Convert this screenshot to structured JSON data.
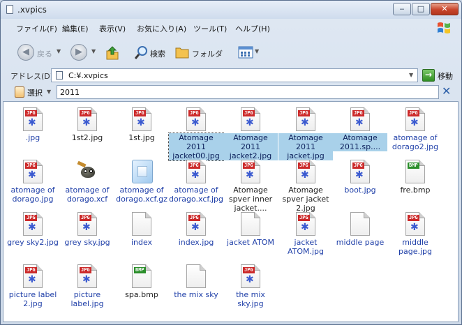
{
  "window": {
    "title": ".xvpics",
    "controls": {
      "minimize": "‒",
      "maximize": "□",
      "close": "✕"
    }
  },
  "menubar": {
    "items": [
      "ファイル(F)",
      "編集(E)",
      "表示(V)",
      "お気に入り(A)",
      "ツール(T)",
      "ヘルプ(H)"
    ]
  },
  "toolbar": {
    "back_label": "戻る",
    "search_label": "検索",
    "folders_label": "フォルダ"
  },
  "addressbar": {
    "label": "アドレス(D)",
    "path": "C:¥.xvpics",
    "go_label": "移動"
  },
  "filterbar": {
    "select_label": "選択",
    "filter_value": "2011"
  },
  "files": [
    {
      "name": ".jpg",
      "type": "jpg",
      "state": "link"
    },
    {
      "name": "1st2.jpg",
      "type": "jpg",
      "state": "plain"
    },
    {
      "name": "1st.jpg",
      "type": "jpg",
      "state": "plain"
    },
    {
      "name": "Atomage 2011 jacket00.jpg",
      "type": "jpg",
      "state": "selected-focus"
    },
    {
      "name": "Atomage 2011 jacket2.jpg",
      "type": "jpg",
      "state": "selected"
    },
    {
      "name": "Atomage 2011 jacket.jpg",
      "type": "jpg",
      "state": "selected"
    },
    {
      "name": "Atomage 2011.sp....",
      "type": "jpg",
      "state": "selected"
    },
    {
      "name": "atomage of dorago2.jpg",
      "type": "jpg",
      "state": "link"
    },
    {
      "name": "atomage of dorago.jpg",
      "type": "jpg",
      "state": "link"
    },
    {
      "name": "atomage of dorago.xcf",
      "type": "xcf",
      "state": "link"
    },
    {
      "name": "atomage of dorago.xcf.gz",
      "type": "gz",
      "state": "link"
    },
    {
      "name": "atomage of dorago.xcf.jpg",
      "type": "jpg",
      "state": "link"
    },
    {
      "name": "Atomage spver inner jacket....",
      "type": "jpg",
      "state": "plain"
    },
    {
      "name": "Atomage spver jacket 2.jpg",
      "type": "jpg",
      "state": "plain"
    },
    {
      "name": "boot.jpg",
      "type": "jpg",
      "state": "link"
    },
    {
      "name": "fre.bmp",
      "type": "bmp",
      "state": "plain"
    },
    {
      "name": "grey sky2.jpg",
      "type": "jpg",
      "state": "link"
    },
    {
      "name": "grey sky.jpg",
      "type": "jpg",
      "state": "link"
    },
    {
      "name": "index",
      "type": "blank",
      "state": "link"
    },
    {
      "name": "index.jpg",
      "type": "jpg",
      "state": "link"
    },
    {
      "name": "jacket ATOM",
      "type": "blank",
      "state": "link"
    },
    {
      "name": "jacket ATOM.jpg",
      "type": "jpg",
      "state": "link"
    },
    {
      "name": "middle page",
      "type": "blank",
      "state": "link"
    },
    {
      "name": "middle page.jpg",
      "type": "jpg",
      "state": "link"
    },
    {
      "name": "picture label 2.jpg",
      "type": "jpg",
      "state": "link"
    },
    {
      "name": "picture label.jpg",
      "type": "jpg",
      "state": "link"
    },
    {
      "name": "spa.bmp",
      "type": "bmp",
      "state": "plain"
    },
    {
      "name": "the mix sky",
      "type": "blank",
      "state": "link"
    },
    {
      "name": "the mix sky.jpg",
      "type": "jpg",
      "state": "link"
    }
  ],
  "badges": {
    "jpg": "JPG",
    "bmp": "BMP"
  },
  "colors": {
    "link": "#1f3fa8",
    "selection": "#a9d1ea",
    "jpg_badge": "#cc2a2a",
    "bmp_badge": "#2b8f2b"
  }
}
